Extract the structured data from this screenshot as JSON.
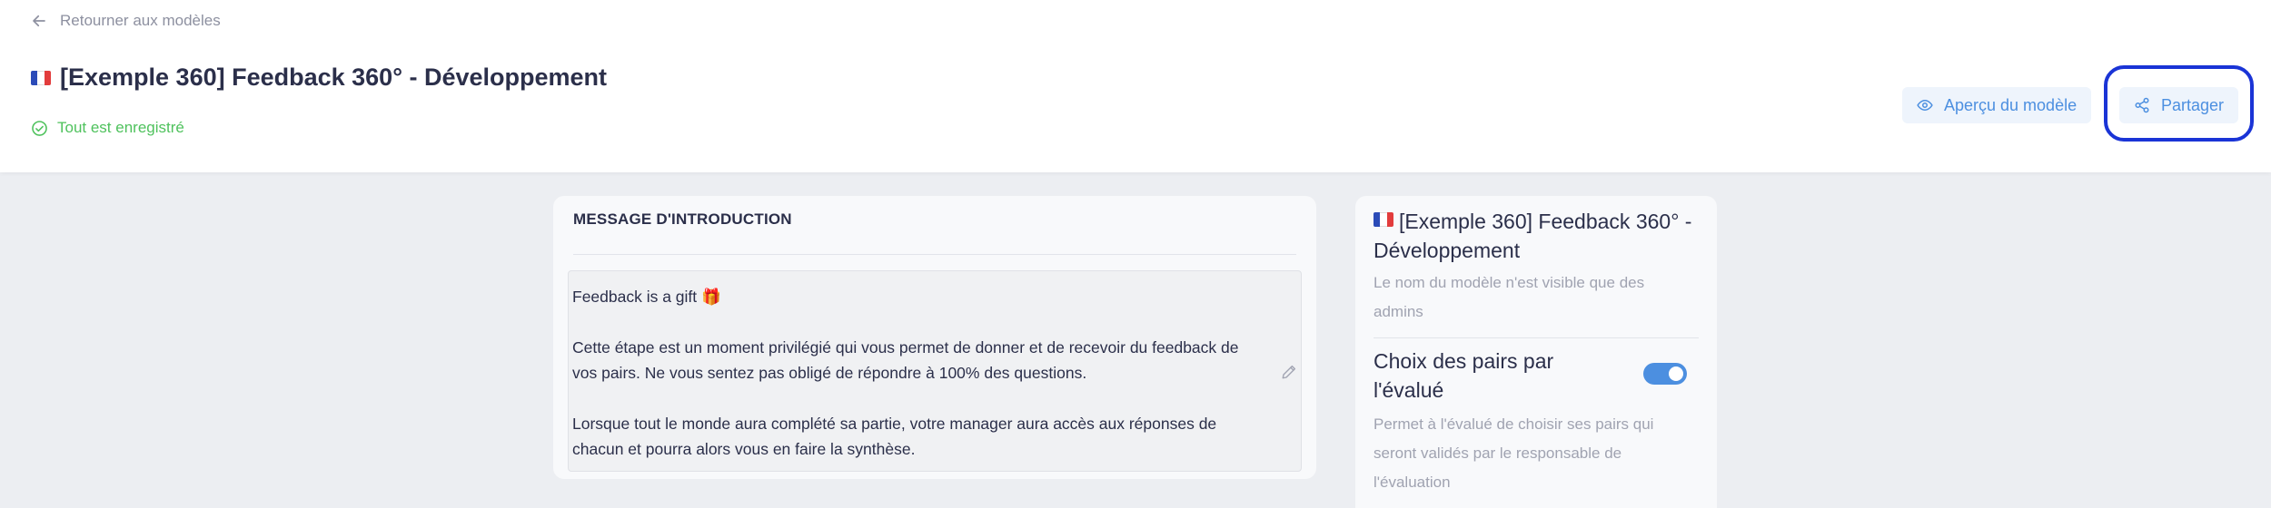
{
  "header": {
    "back_label": "Retourner aux modèles",
    "title": "[Exemple 360] Feedback 360° - Développement",
    "save_status": "Tout est enregistré",
    "preview_label": "Aperçu du modèle",
    "share_label": "Partager"
  },
  "intro": {
    "heading": "MESSAGE D'INTRODUCTION",
    "paragraph1": "Feedback is a gift 🎁",
    "paragraph2": "Cette étape est un moment privilégié qui vous permet de donner et de recevoir du feedback de vos pairs. Ne vous sentez pas obligé de répondre à 100% des questions.",
    "paragraph3": "Lorsque tout le monde aura complété sa partie, votre manager aura accès aux réponses de chacun et pourra alors vous en faire la synthèse."
  },
  "settings": {
    "model_name": "[Exemple 360] Feedback 360° - Développement",
    "model_name_note": "Le nom du modèle n'est visible que des admins",
    "peer_choice_label": "Choix des pairs par l'évalué",
    "peer_choice_enabled": true,
    "peer_choice_description": "Permet à l'évalué de choisir ses pairs qui seront validés par le responsable de l'évaluation"
  },
  "colors": {
    "accent": "#4c8fe0",
    "success": "#4fc25d",
    "highlight": "#1a34d6"
  }
}
